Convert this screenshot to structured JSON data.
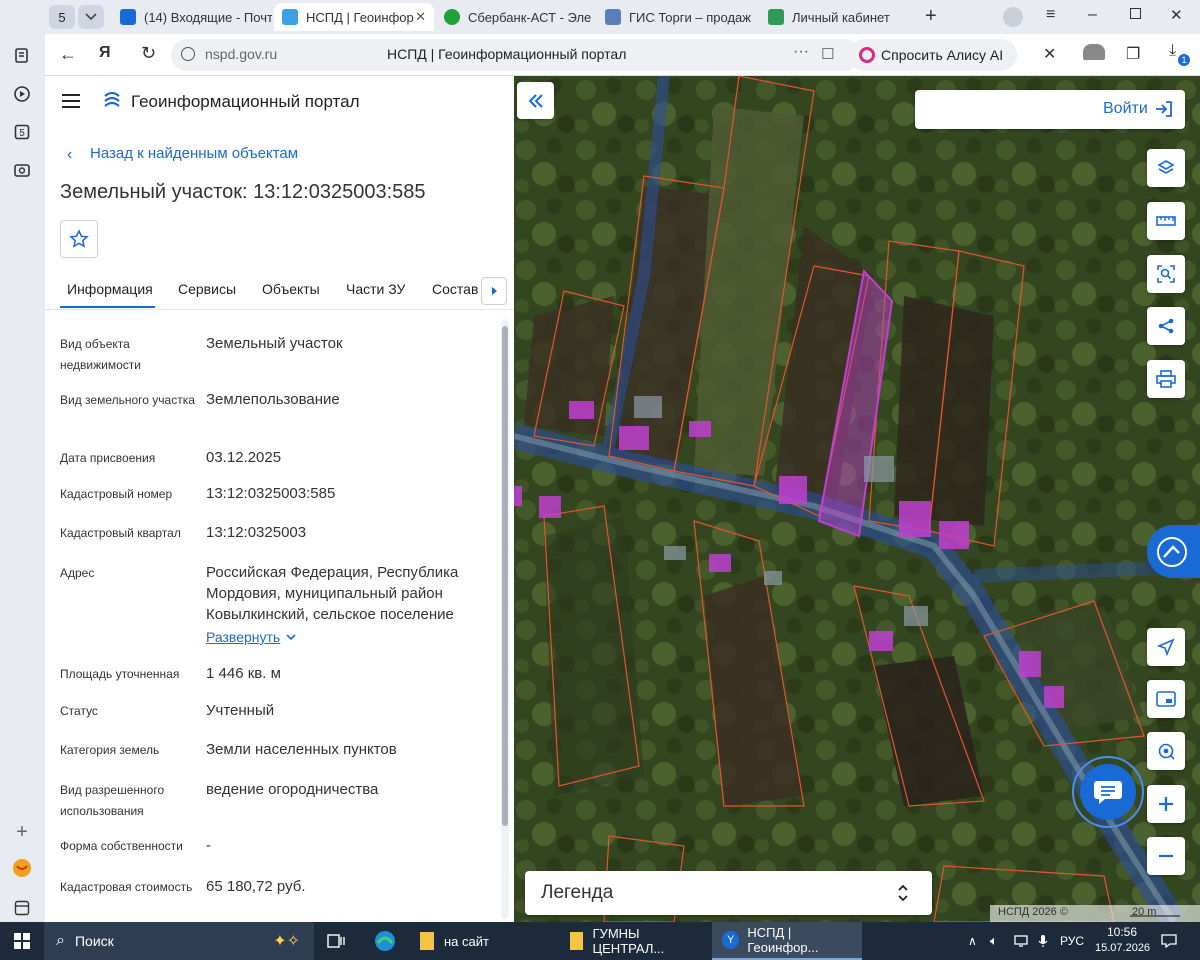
{
  "browser": {
    "tab_count": "5",
    "tabs": [
      {
        "label": "(14) Входящие - Почт"
      },
      {
        "label": "НСПД | Геоинформ"
      },
      {
        "label": "Сбербанк-АСТ - Элек"
      },
      {
        "label": "ГИС Торги – продаж"
      },
      {
        "label": "Личный кабинет"
      }
    ],
    "url": "nspd.gov.ru",
    "page_title": "НСПД | Геоинформационный портал",
    "alice_label": "Спросить Алису AI",
    "download_badge": "1"
  },
  "portal": {
    "title": "Геоинформационный портал",
    "back_link": "Назад к найденным объектам",
    "object_title": "Земельный участок: 13:12:0325003:585",
    "tabs": [
      "Информация",
      "Сервисы",
      "Объекты",
      "Части ЗУ",
      "Состав"
    ],
    "rows": [
      {
        "label": "Вид объекта недвижимости",
        "value": "Земельный участок"
      },
      {
        "label": "Вид земельного участка",
        "value": "Землепользование"
      },
      {
        "label": "Дата присвоения",
        "value": "03.12.2025"
      },
      {
        "label": "Кадастровый номер",
        "value": "13:12:0325003:585"
      },
      {
        "label": "Кадастровый квартал",
        "value": "13:12:0325003"
      },
      {
        "label": "Адрес",
        "value": "Российская Федерация, Республика Мордовия, муниципальный район Ковылкинский, сельское поселение"
      },
      {
        "label": "Площадь уточненная",
        "value": "1 446 кв. м"
      },
      {
        "label": "Статус",
        "value": "Учтенный"
      },
      {
        "label": "Категория земель",
        "value": "Земли населенных пунктов"
      },
      {
        "label": "Вид разрешенного использования",
        "value": "ведение огородничества"
      },
      {
        "label": "Форма собственности",
        "value": "-"
      },
      {
        "label": "Кадастровая стоимость",
        "value": "65 180,72 руб."
      }
    ],
    "expand_link": "Развернуть"
  },
  "map": {
    "login_label": "Войти",
    "legend_label": "Легенда",
    "attribution": "НСПД 2026 ©",
    "scale_label": "20 m"
  },
  "taskbar": {
    "search_label": "Поиск",
    "apps": [
      {
        "label": "на сайт"
      },
      {
        "label": "ГУМНЫ ЦЕНТРАЛ..."
      },
      {
        "label": "НСПД | Геоинфор..."
      }
    ],
    "lang": "РУС",
    "time": "10:56",
    "date": "15.07.2026"
  },
  "colors": {
    "accent": "#1a6ad6",
    "plot_border": "#e2552f",
    "selected_plot": "#c040d0"
  }
}
